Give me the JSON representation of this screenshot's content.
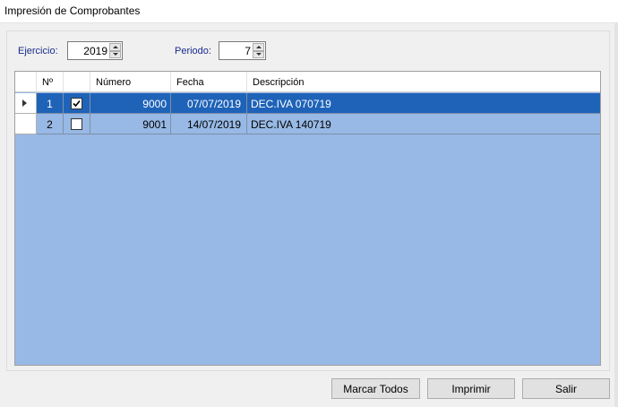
{
  "window": {
    "title": "Impresión de Comprobantes"
  },
  "filters": {
    "ejercicio_label": "Ejercicio:",
    "ejercicio_value": "2019",
    "periodo_label": "Periodo:",
    "periodo_value": "7"
  },
  "table": {
    "columns": [
      "Nº",
      "",
      "Número",
      "Fecha",
      "Descripción"
    ],
    "rows": [
      {
        "n": "1",
        "checked": true,
        "numero": "9000",
        "fecha": "07/07/2019",
        "descripcion": "DEC.IVA 070719",
        "selected": true
      },
      {
        "n": "2",
        "checked": false,
        "numero": "9001",
        "fecha": "14/07/2019",
        "descripcion": "DEC.IVA 140719",
        "selected": false
      }
    ],
    "selected_color": "#1f63b8",
    "background_color": "#98b9e5"
  },
  "buttons": {
    "mark_all": "Marcar Todos",
    "print": "Imprimir",
    "exit": "Salir"
  }
}
